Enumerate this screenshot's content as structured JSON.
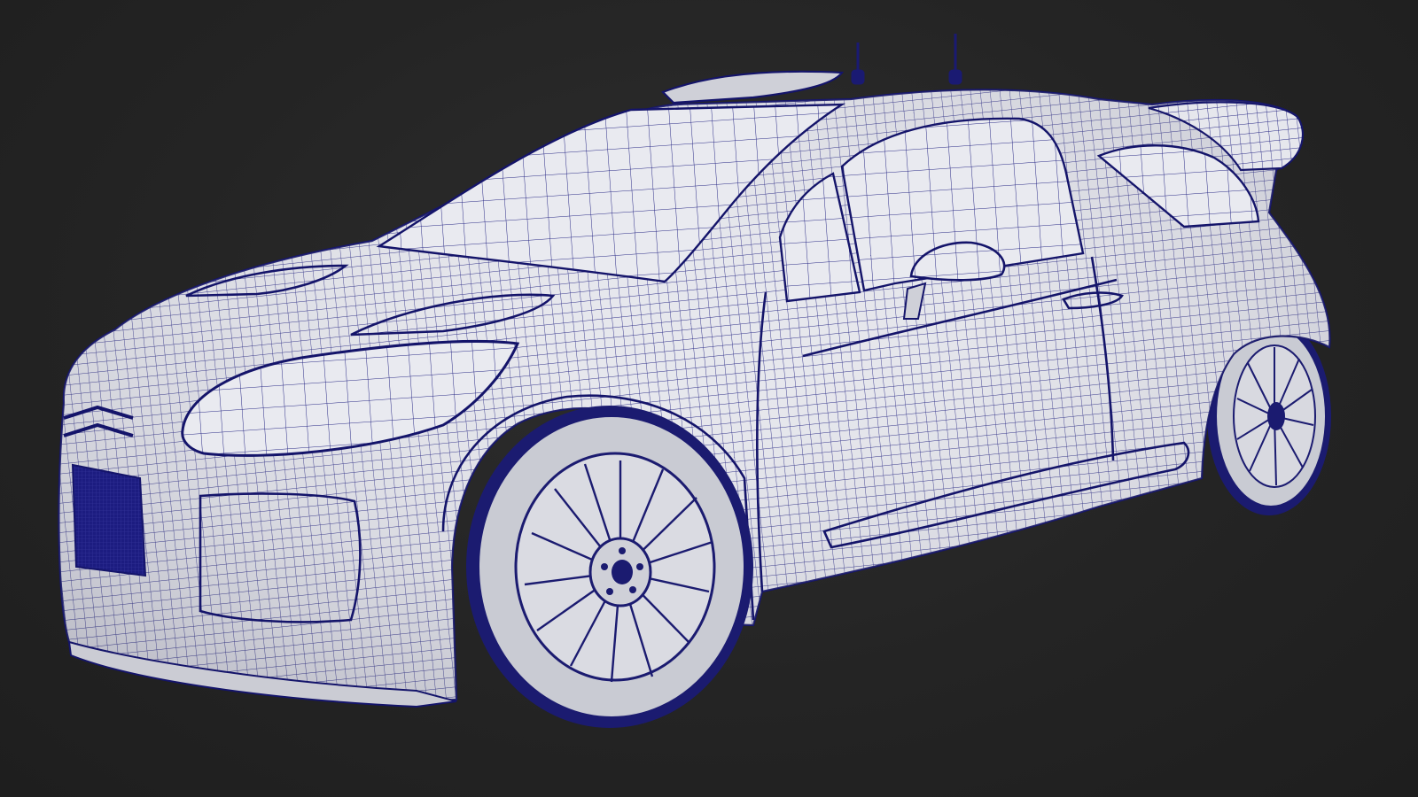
{
  "scene": {
    "subject": "rally-car-wireframe",
    "background_color": "#262626",
    "mesh_color": "#1a1a72",
    "surface_color": "#e7e8ee",
    "grille_color": "#1c1c80"
  }
}
